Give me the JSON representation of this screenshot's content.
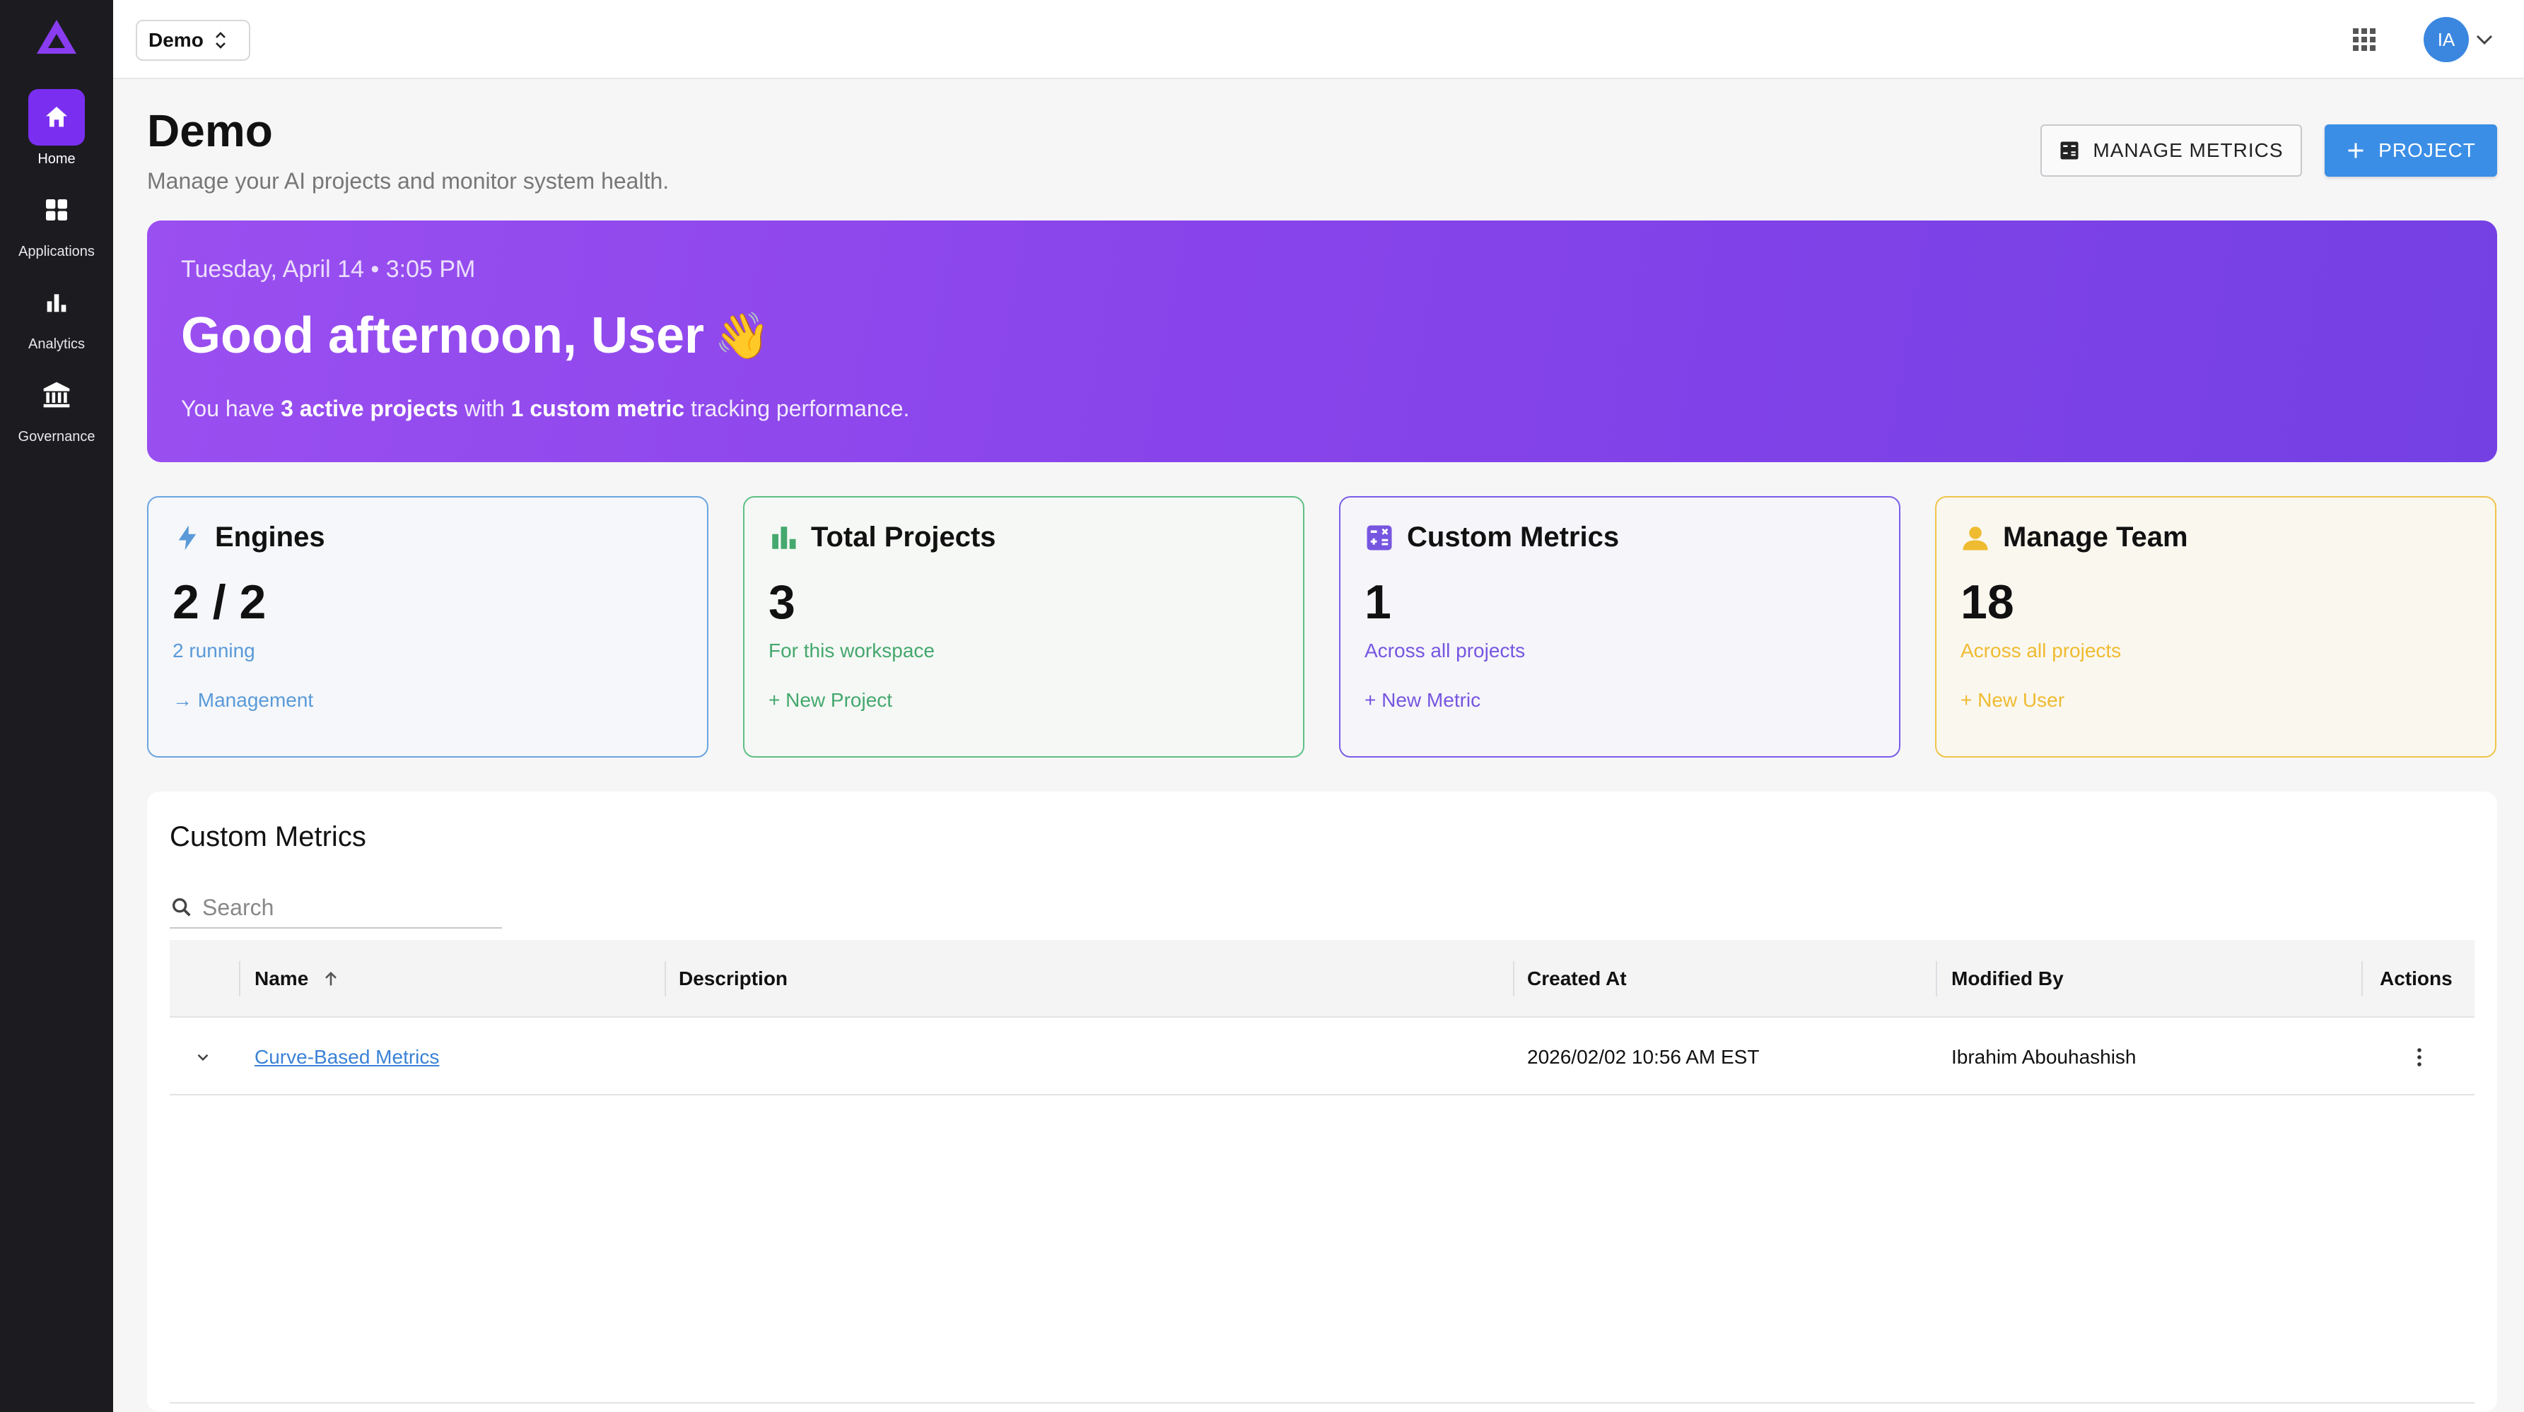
{
  "sidebar": {
    "items": [
      {
        "label": "Home",
        "icon": "home-icon",
        "active": true
      },
      {
        "label": "Applications",
        "icon": "grid-icon",
        "active": false
      },
      {
        "label": "Analytics",
        "icon": "bar-chart-icon",
        "active": false
      },
      {
        "label": "Governance",
        "icon": "bank-icon",
        "active": false
      }
    ]
  },
  "topbar": {
    "workspace": "Demo",
    "avatar_initials": "IA"
  },
  "header": {
    "title": "Demo",
    "subtitle": "Manage your AI projects and monitor system health.",
    "manage_metrics_label": "MANAGE METRICS",
    "project_label": "PROJECT"
  },
  "banner": {
    "date": "Tuesday, April 14 • 3:05 PM",
    "greeting": "Good afternoon, User",
    "emoji": "👋",
    "summary_prefix": "You have ",
    "summary_projects": "3 active projects",
    "summary_mid": " with ",
    "summary_metric": "1 custom metric",
    "summary_suffix": " tracking performance."
  },
  "cards": [
    {
      "title": "Engines",
      "value": "2 / 2",
      "sub": "2 running",
      "link": "→ Management"
    },
    {
      "title": "Total Projects",
      "value": "3",
      "sub": "For this workspace",
      "link": "+ New Project"
    },
    {
      "title": "Custom Metrics",
      "value": "1",
      "sub": "Across all projects",
      "link": "+ New Metric"
    },
    {
      "title": "Manage Team",
      "value": "18",
      "sub": "Across all projects",
      "link": "+ New User"
    }
  ],
  "table": {
    "title": "Custom Metrics",
    "search_placeholder": "Search",
    "columns": [
      "Name",
      "Description",
      "Created At",
      "Modified By",
      "Actions"
    ],
    "rows": [
      {
        "name": "Curve-Based Metrics",
        "description": "",
        "created_at": "2026/02/02 10:56 AM EST",
        "modified_by": "Ibrahim Abouhashish"
      }
    ]
  },
  "colors": {
    "accent": "#7a2ff0",
    "primary_button": "#3a8ee6",
    "sidebar_bg": "#1c1c20",
    "engines": "#5a9ad8",
    "projects": "#45a86e",
    "metrics": "#7656e0",
    "team": "#efbb30"
  }
}
